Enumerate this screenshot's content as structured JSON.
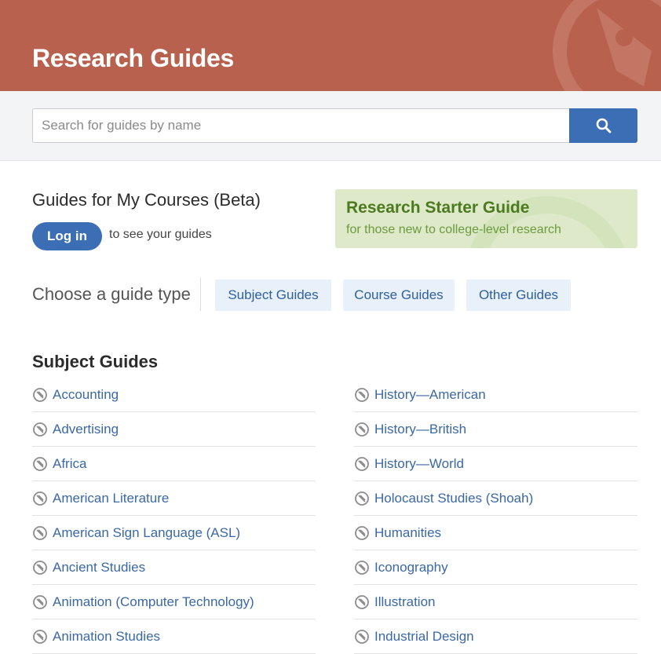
{
  "header": {
    "title": "Research Guides"
  },
  "search": {
    "placeholder": "Search for guides by name"
  },
  "courses": {
    "heading": "Guides for My Courses (Beta)",
    "login_label": "Log in",
    "note": "to see your guides"
  },
  "starter": {
    "title": "Research Starter Guide",
    "subtitle": "for those new to college-level research"
  },
  "chooser": {
    "label": "Choose a guide type",
    "types": [
      "Subject Guides",
      "Course Guides",
      "Other Guides"
    ]
  },
  "subject_guides": {
    "heading": "Subject Guides",
    "left": [
      "Accounting",
      "Advertising",
      "Africa",
      "American Literature",
      "American Sign Language (ASL)",
      "Ancient Studies",
      "Animation (Computer Technology)",
      "Animation Studies"
    ],
    "right": [
      "History—American",
      "History—British",
      "History—World",
      "Holocaust Studies (Shoah)",
      "Humanities",
      "Iconography",
      "Illustration",
      "Industrial Design"
    ]
  },
  "colors": {
    "header_bg": "#b8614e",
    "accent_blue": "#3b6eb4",
    "starter_bg": "#dde9c9",
    "link": "#3a68a6"
  },
  "icons": {
    "search": "search-icon",
    "guide_item": "compass-icon"
  }
}
